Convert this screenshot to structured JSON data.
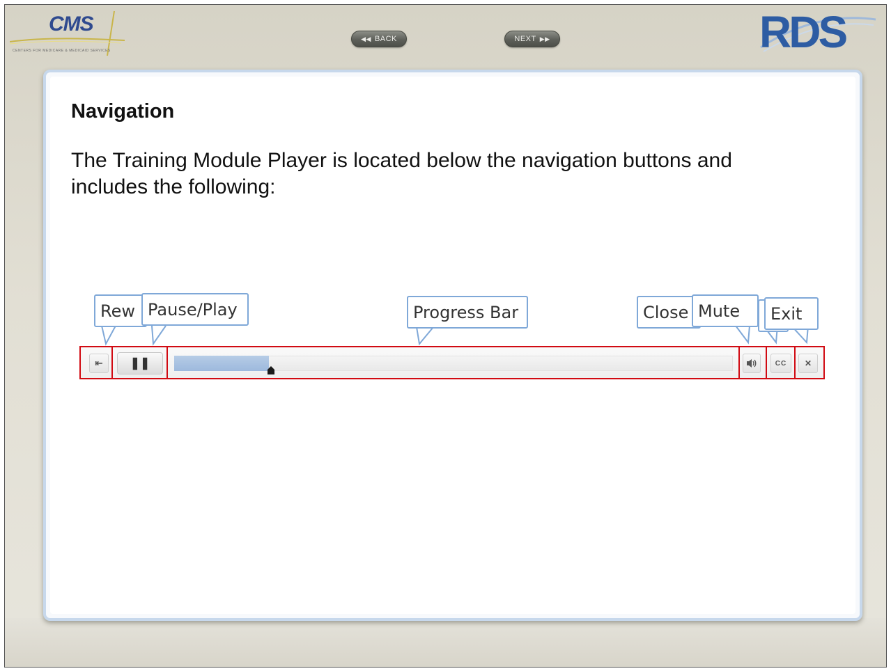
{
  "header": {
    "cms_logo_text": "CMS",
    "cms_logo_subtitle": "CENTERS FOR MEDICARE & MEDICAID SERVICES",
    "back_label": "BACK",
    "next_label": "NEXT",
    "rds_logo_text": "RDS"
  },
  "content": {
    "heading": "Navigation",
    "intro": "The Training Module Player is located below the navigation buttons and includes the following:"
  },
  "player": {
    "progress_fraction": 0.17,
    "controls": [
      {
        "name": "rewind",
        "icon": "rewind-icon",
        "glyph": "⇤"
      },
      {
        "name": "pause-play",
        "icon": "pause-icon",
        "glyph": "II"
      },
      {
        "name": "mute",
        "icon": "speaker-icon",
        "glyph": "🔊"
      },
      {
        "name": "closed-caption",
        "icon": "cc-icon",
        "glyph": "CC"
      },
      {
        "name": "exit",
        "icon": "close-icon",
        "glyph": "✕"
      }
    ]
  },
  "callouts": {
    "rewind": "Rew",
    "pause_play": "Pause/Play",
    "progress_bar": "Progress Bar",
    "close_caption": "Close",
    "mute": "Mute",
    "exit": "Exit"
  },
  "colors": {
    "highlight_border": "#d10a12",
    "callout_border": "#7fa8d8",
    "progress_fill": "#9db9dd",
    "rds_blue": "#2d5ca3",
    "cms_blue": "#2f4a8f"
  }
}
